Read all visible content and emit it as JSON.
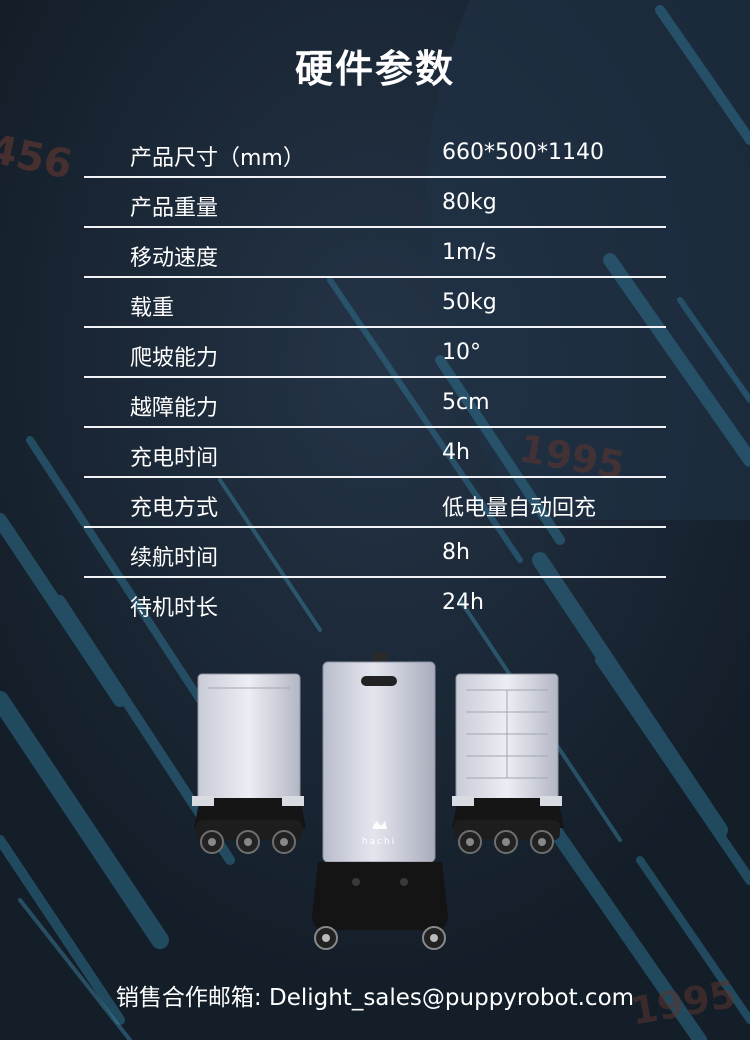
{
  "page": {
    "title": "硬件参数",
    "footer": "销售合作邮箱: Delight_sales@puppyrobot.com"
  },
  "specs": [
    {
      "label": "产品尺寸（mm）",
      "value": "660*500*1140"
    },
    {
      "label": "产品重量",
      "value": "80kg"
    },
    {
      "label": "移动速度",
      "value": "1m/s"
    },
    {
      "label": "载重",
      "value": "50kg"
    },
    {
      "label": "爬坡能力",
      "value": "10°"
    },
    {
      "label": "越障能力",
      "value": "5cm"
    },
    {
      "label": "充电时间",
      "value": "4h"
    },
    {
      "label": "充电方式",
      "value": "低电量自动回充"
    },
    {
      "label": "续航时间",
      "value": "8h"
    },
    {
      "label": "待机时长",
      "value": "24h"
    }
  ],
  "background": {
    "numbers": [
      "456",
      "1995",
      "1995"
    ]
  },
  "robot": {
    "brand": "hachi"
  },
  "colors": {
    "background": "#1b2836",
    "stripe": "#2f6f8c",
    "table_rule": "#f1f3f6",
    "text": "#ffffff",
    "faded_number": "#5a3530"
  }
}
